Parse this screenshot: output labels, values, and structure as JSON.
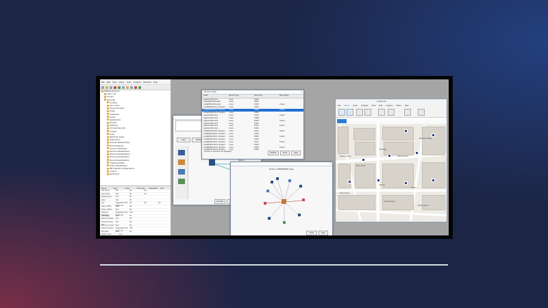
{
  "left_app": {
    "menu": [
      "File",
      "Edit",
      "View",
      "Query",
      "Tools",
      "Analysis",
      "Windows",
      "Help"
    ],
    "tree": [
      "Maltego Explorer",
      "Users List",
      "Groups",
      "Personal",
      "Location",
      "Item Users",
      "Phone Numbers",
      "Email",
      "Addresses",
      "Social",
      "Applications",
      "Devices",
      "Websites",
      "Criminal Records",
      "Contact",
      "Links",
      "Matching Cases",
      "Telephones",
      "Network Relationships",
      "Event Evidence",
      "Account Matchings",
      "Record Classifications",
      "Record Classifications",
      "Record Identifications",
      "Record Identifications",
      "Tracking Entities",
      "Entity Classification",
      "DB Analysis Configurations",
      "Custom",
      "Exclusions"
    ],
    "props_header": [
      "Name",
      "Type",
      "Order",
      "Terminate",
      "Calculation",
      "Use"
    ],
    "props_rows": [
      [
        "Full Name",
        "Text",
        "50",
        "Yes",
        ""
      ],
      [
        "Last Name",
        "Text",
        "60",
        "Yes",
        ""
      ],
      [
        "Middle Name",
        "Text",
        "55",
        "",
        ""
      ],
      [
        "Alias",
        "Text",
        "25",
        "",
        ""
      ],
      [
        "Sex",
        "Suggested Text Code List",
        "60",
        "Yes",
        "Yes"
      ],
      [
        "Date of Birth",
        "Date",
        "80",
        "",
        ""
      ],
      [
        "Place of Birth",
        "Text",
        "50",
        "",
        ""
      ],
      [
        "Passport Numbers",
        "Suggested Text Code List",
        "100",
        "",
        ""
      ],
      [
        "Nationality",
        "Text",
        "25",
        "",
        ""
      ],
      [
        "Identity Number",
        "Text",
        "35",
        "",
        ""
      ],
      [
        "Social Security No.",
        "Text",
        "60",
        "",
        ""
      ],
      [
        "Driver's Licence",
        "Text",
        "60",
        "",
        ""
      ],
      [
        "Phone Number",
        "Suggested Text Code List",
        "100",
        "",
        ""
      ],
      [
        "Remarks",
        "Text",
        "50",
        "",
        ""
      ],
      [
        "Height Code",
        "Text",
        "",
        ""
      ],
      [
        "Weight",
        "Text",
        "",
        ""
      ],
      [
        "Hair Color",
        "Suggested Text Code List",
        "100",
        "",
        ""
      ],
      [
        "Eye Color",
        "Suggested Text Code List",
        "100",
        "",
        ""
      ]
    ]
  },
  "data_window": {
    "title": "Results Table",
    "columns": [
      "Label",
      "Record Type",
      "Name Key",
      "Data Status"
    ],
    "rows": [
      [
        "Lagerfeld Bonvena",
        "1 item",
        "10001",
        "",
        ""
      ],
      [
        "LAGERFELD Bonvalle",
        "1 item",
        "10002",
        "",
        ""
      ],
      [
        "LAGERFELD Bonvalle",
        "1 item",
        "10003",
        "Linked",
        "Linked"
      ],
      [
        "LAGERFELD Bonv Stoeptes",
        "1 item",
        "10004",
        "",
        ""
      ],
      [
        "LAGERFELD Bonv Stoeptes",
        "1 item",
        "10005",
        "Linked",
        "Linked"
      ],
      [
        "LAGERFELD Bonv Stoeptes",
        "1 item",
        "10006",
        "",
        ""
      ],
      [
        "Lagerfeld Bonvena",
        "1 item",
        "10007",
        "Linked",
        "Linked"
      ],
      [
        "Lagerfeld Bonvena",
        "1 item",
        "10008",
        "",
        ""
      ],
      [
        "Lagerfeld Bonvena",
        "1 item",
        "10009",
        "Linked",
        "Linked"
      ],
      [
        "Lagerfeld Bonvena",
        "1 item",
        "10010",
        "",
        ""
      ],
      [
        "Lagerfeld Bonvena",
        "1 item",
        "10011",
        "Linked",
        "Linked"
      ],
      [
        "Lagerfeld Bonvena",
        "1 item",
        "10012",
        "",
        ""
      ],
      [
        "LAGERFELD Bonv Stoeptes",
        "1 item",
        "10013",
        "Linked",
        "Linked"
      ],
      [
        "LAGERFELD Bonv Stoeptes",
        "1 item",
        "10014",
        "",
        ""
      ],
      [
        "LAGERFELD Bonv Stoeptes",
        "1 item",
        "10015",
        "Linked",
        "Linked"
      ],
      [
        "LAGERFELD Bonv Stoeptes",
        "1 item",
        "10016",
        "",
        ""
      ],
      [
        "LAGERFELD Bonv Stoeptes",
        "1 item",
        "10017",
        "Linked",
        "Linked"
      ],
      [
        "LAGERFELD Bonv Stoeptes",
        "1 item",
        "10018",
        "",
        ""
      ],
      [
        "LAGERFELD Bonv Stoeptes",
        "1 item",
        "10019",
        "Linked",
        "Linked"
      ],
      [
        "LAGERFELD Bonv Stoeptes",
        "1 item",
        "10020",
        "",
        ""
      ]
    ],
    "footer": "Number of records to be displayed",
    "buttons": [
      "Refresh",
      "Close",
      "Help"
    ]
  },
  "graph_window": {
    "buttons": [
      "Insert",
      "Delete"
    ],
    "nodes": [
      "Entity 1",
      "Entity 2"
    ],
    "footer_buttons": [
      "Set Alias",
      "Ok",
      "Cancel",
      "Help"
    ]
  },
  "network_window": {
    "title": "Person: 2000009150 Case",
    "buttons": [
      "Close",
      "Help"
    ]
  },
  "map_app": {
    "tabs": [
      "File",
      "Home",
      "Insert",
      "Analysis",
      "View",
      "Edit",
      "Imagery",
      "Share",
      "Help"
    ],
    "title": "ArcGIS Pro",
    "labels": [
      "Blackfriars Bridge",
      "Broadway",
      "Mulberry Street",
      "Hastings Street",
      "Stone Street",
      "Bowery",
      "Prince Street",
      "Church",
      "Lafayette Street",
      "Broome Street"
    ]
  },
  "colors": {
    "accent": "#1f6fd1",
    "background": "#1c2546"
  }
}
